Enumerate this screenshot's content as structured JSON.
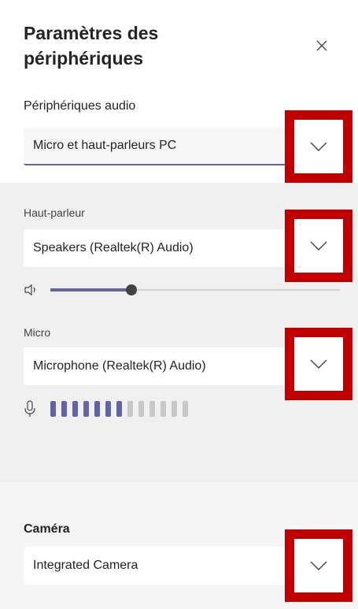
{
  "dialog": {
    "title": "Paramètres des périphériques"
  },
  "audio_devices": {
    "label": "Périphériques audio",
    "selected": "Micro et haut-parleurs PC"
  },
  "speaker": {
    "label": "Haut-parleur",
    "selected": "Speakers (Realtek(R) Audio)",
    "volume_fraction": 0.28
  },
  "microphone": {
    "label": "Micro",
    "selected": "Microphone (Realtek(R) Audio)",
    "level_total": 13,
    "level_active": 7
  },
  "camera": {
    "label": "Caméra",
    "selected": "Integrated Camera"
  },
  "colors": {
    "accent": "#6264a7",
    "highlight": "#c00000"
  },
  "icons": {
    "close": "close-icon",
    "chevron": "chevron-down-icon",
    "speaker": "speaker-icon",
    "mic": "microphone-icon"
  }
}
